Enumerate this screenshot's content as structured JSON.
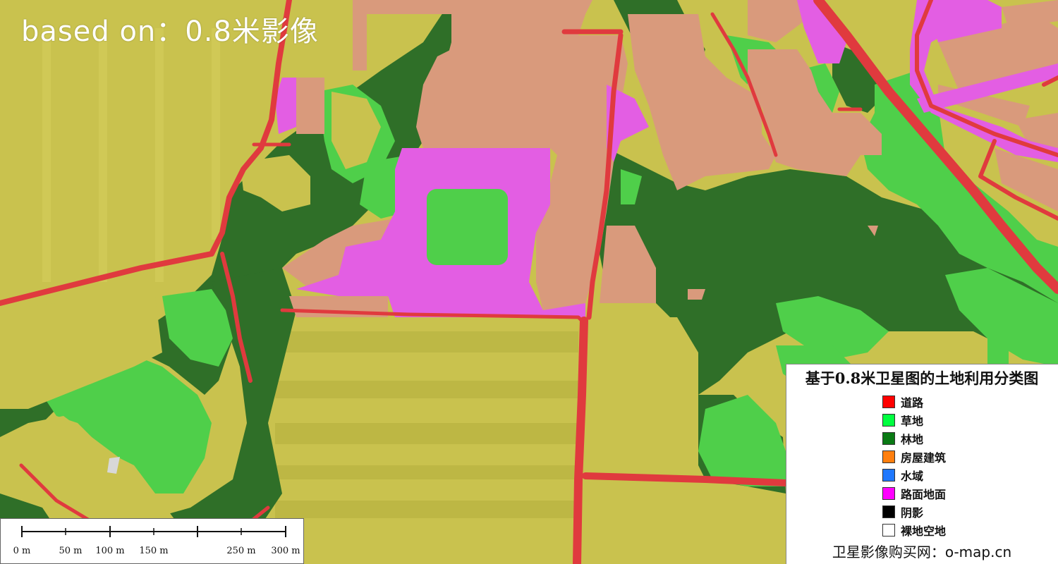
{
  "watermark": "based on：0.8米影像",
  "legend": {
    "title": "基于0.8米卫星图的土地利用分类图",
    "items": [
      {
        "label": "道路",
        "color": "#ff0000"
      },
      {
        "label": "草地",
        "color": "#00ff40"
      },
      {
        "label": "林地",
        "color": "#0a7a14"
      },
      {
        "label": "房屋建筑",
        "color": "#ff7f0e"
      },
      {
        "label": "水域",
        "color": "#1f78ff"
      },
      {
        "label": "路面地面",
        "color": "#ff00ff"
      },
      {
        "label": "阴影",
        "color": "#000000"
      },
      {
        "label": "裸地空地",
        "color": "#ffffff"
      }
    ],
    "footer": "卫星影像购买网：o-map.cn"
  },
  "scalebar": {
    "labels": [
      "0 m",
      "50 m",
      "100 m",
      "150 m",
      "250 m",
      "300 m"
    ]
  },
  "map_colors": {
    "cropland": "#c9c24e",
    "forest": "#2f6f28",
    "grassland": "#4fcf4a",
    "building": "#d99a7c",
    "paved": "#e35ee3",
    "road": "#e03a3e",
    "bare": "#b9c9b9"
  }
}
